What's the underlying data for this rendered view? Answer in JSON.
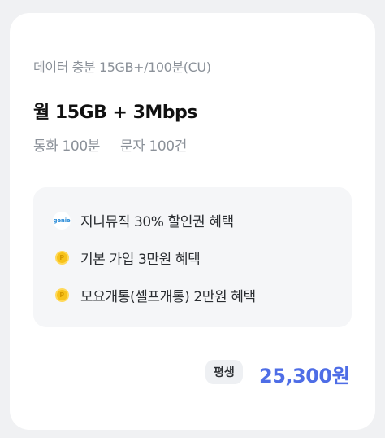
{
  "plan": {
    "subtitle": "데이터 충분 15GB+/100분(CU)",
    "title": "월 15GB + 3Mbps",
    "call": "통화 100분",
    "sms": "문자 100건"
  },
  "benefits": [
    {
      "icon": "genie-icon",
      "icon_text": "genie",
      "label": "지니뮤직 30% 할인권 혜택"
    },
    {
      "icon": "coin-icon",
      "icon_text": "P",
      "label": "기본 가입 3만원 혜택"
    },
    {
      "icon": "coin-icon",
      "icon_text": "P",
      "label": "모요개통(셀프개통) 2만원 혜택"
    }
  ],
  "pricing": {
    "badge": "평생",
    "price": "25,300원"
  },
  "colors": {
    "accent": "#4e6de6",
    "coin": "#f7c21a",
    "genie": "#2a8cd8"
  }
}
